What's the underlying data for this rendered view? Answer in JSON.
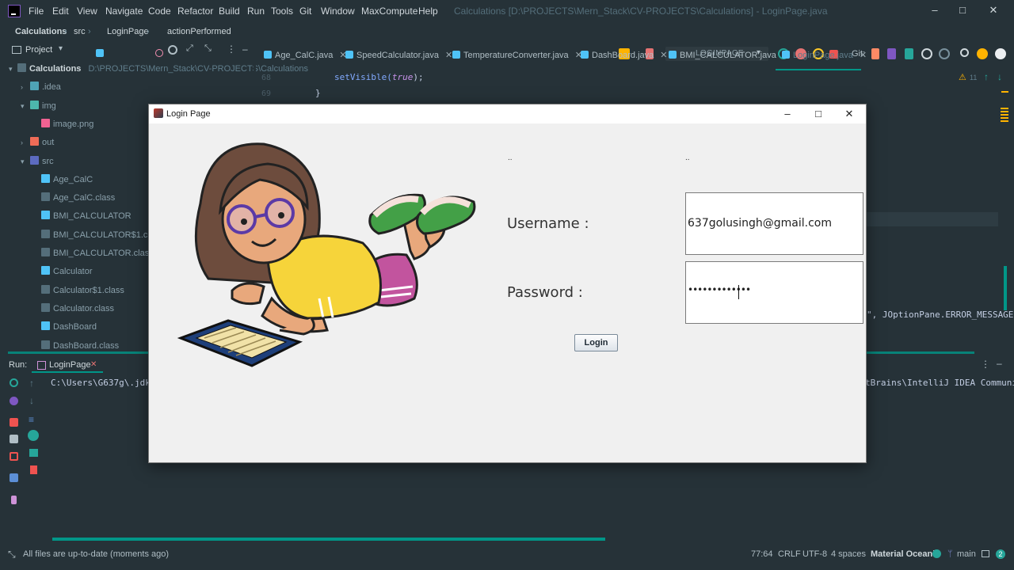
{
  "menubar": {
    "items": [
      "File",
      "Edit",
      "View",
      "Navigate",
      "Code",
      "Refactor",
      "Build",
      "Run",
      "Tools",
      "Git",
      "Window",
      "MaxCompute",
      "Help"
    ],
    "title": "Calculations [D:\\PROJECTS\\Mern_Stack\\CV-PROJECTS\\Calculations] - LoginPage.java"
  },
  "navbar": {
    "crumbs": [
      "Calculations",
      "src",
      "LoginPage",
      "actionPerformed"
    ],
    "run_config": "LOGINPAGE",
    "git_label": "Git:"
  },
  "project": {
    "title": "Project",
    "root_label": "Calculations",
    "root_path": "D:\\PROJECTS\\Mern_Stack\\CV-PROJECTS\\Calculations",
    "items": [
      ".idea",
      "img",
      "image.png",
      "out",
      "src",
      "Age_CalC",
      "Age_CalC.class",
      "BMI_CALCULATOR",
      "BMI_CALCULATOR$1.class",
      "BMI_CALCULATOR.class",
      "Calculator",
      "Calculator$1.class",
      "Calculator.class",
      "DashBoard",
      "DashBoard.class"
    ]
  },
  "editor": {
    "tabs": [
      "Age_CalC.java",
      "SpeedCalculator.java",
      "TemperatureConverter.java",
      "DashBoard.java",
      "BMI_CALCULATOR.java",
      "LoginPage.java"
    ],
    "line68": "68",
    "line69": "69",
    "code68_method": "setVisible(",
    "code68_arg": "true",
    "code68_end": ");",
    "code69": "}",
    "warning_count": "11",
    "code_right": "\", JOptionPane.ERROR_MESSAGE);"
  },
  "run": {
    "label": "Run:",
    "tab": "LoginPage",
    "console_left": "C:\\Users\\G637g\\.jdks\\",
    "console_right": "tBrains\\IntelliJ IDEA Communi"
  },
  "status": {
    "message": "All files are up-to-date (moments ago)",
    "position": "77:64",
    "line_sep": "CRLF",
    "encoding": "UTF-8",
    "indent": "4 spaces",
    "theme": "Material Oceanic",
    "branch": "main",
    "count": "2"
  },
  "login": {
    "window_title": "Login Page",
    "dots1": "..",
    "dots2": "..",
    "username_label": "Username :",
    "username_value": "637golusingh@gmail.com",
    "password_label": "Password :",
    "password_value": "•••••••••••••",
    "login_button": "Login"
  },
  "colors": {
    "ide_bg": "#263238",
    "accent": "#009688",
    "swing_bg": "#f0f0f0"
  }
}
